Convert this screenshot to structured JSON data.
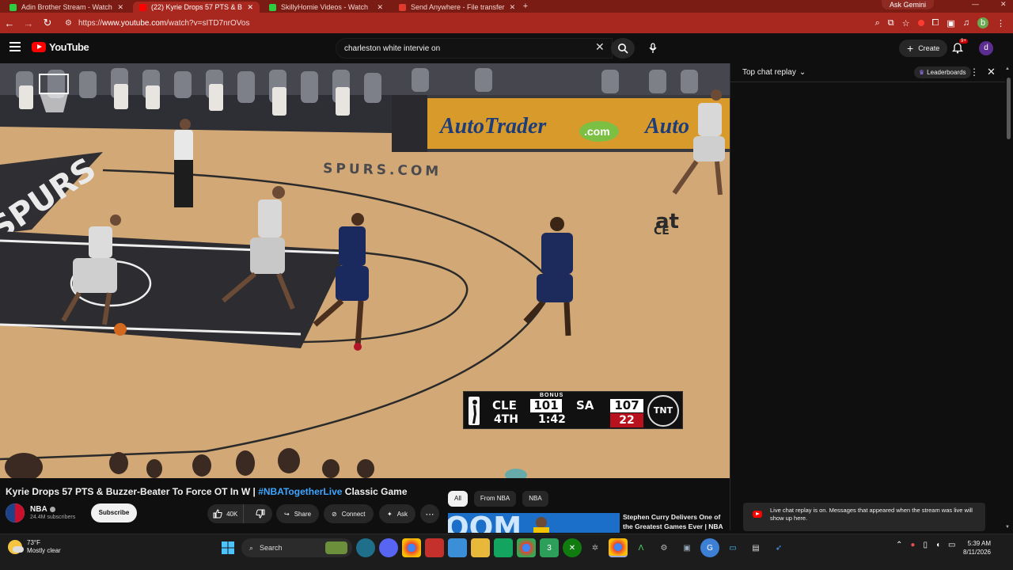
{
  "browser": {
    "tabs": [
      {
        "label": "Adin Brother Stream - Watch",
        "favicon": "green"
      },
      {
        "label": "(22) Kyrie Drops 57 PTS & B",
        "favicon": "youtube",
        "active": true
      },
      {
        "label": "SkillyHomie Videos - Watch",
        "favicon": "green"
      },
      {
        "label": "Send Anywhere - File transfer",
        "favicon": "red"
      }
    ],
    "ask_gemini": "Ask Gemini",
    "url_prefix": "https://",
    "url_domain": "www.youtube.com",
    "url_path": "/watch?v=sITD7nrOVos",
    "theme_color": "#a8281f"
  },
  "youtube": {
    "logo_text": "YouTube",
    "search_value": "charleston white intervie on",
    "create_label": "Create",
    "notifications_badge": "9+",
    "avatar_letter": "d"
  },
  "scoreboard": {
    "bonus": "BONUS",
    "team1": "CLE",
    "score1": "101",
    "team2": "SA",
    "score2": "107",
    "quarter": "4TH",
    "clock": "1:42",
    "shot_clock": "22",
    "network": "TNT"
  },
  "court": {
    "sign1": "AutoTrader",
    "sign1_com": ".com",
    "sign2": "Auto",
    "baseline": "SPURS.COM",
    "team_wordmark": "SPURS",
    "arena_partial": "at",
    "arena_partial2": "CE"
  },
  "chat": {
    "title": "Top chat replay",
    "leaderboards": "Leaderboards",
    "notice": "Live chat replay is on. Messages that appeared when the stream was live will show up here."
  },
  "video": {
    "title_part1": "Kyrie Drops 57 PTS & Buzzer-Beater To Force OT In W | ",
    "title_hashtag": "#NBATogetherLive",
    "title_part2": " Classic Game",
    "channel": "NBA",
    "subscribers": "24.4M subscribers",
    "subscribe_label": "Subscribe",
    "likes": "40K",
    "share_label": "Share",
    "connect_label": "Connect",
    "ask_label": "Ask"
  },
  "recommendations": {
    "chips": [
      "All",
      "From NBA",
      "NBA"
    ],
    "first_title": "Stephen Curry Delivers One of the Greatest Games Ever | NBA",
    "thumb_text": "OOM"
  },
  "taskbar": {
    "temperature": "73°F",
    "condition": "Mostly clear",
    "search_label": "Search",
    "time": "5:39 AM",
    "date": "8/11/2026"
  }
}
